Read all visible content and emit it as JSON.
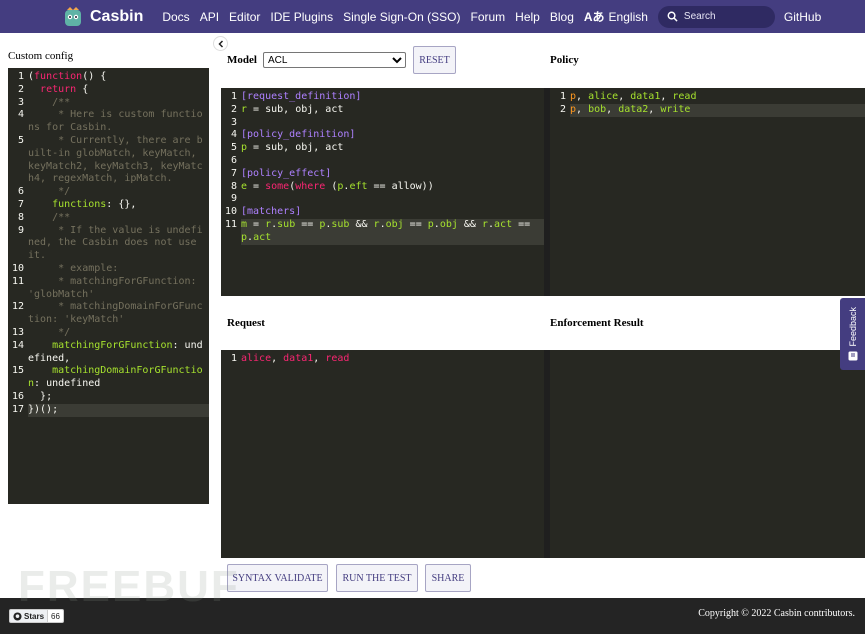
{
  "nav": {
    "brand": "Casbin",
    "links": [
      "Docs",
      "API",
      "Editor",
      "IDE Plugins",
      "Single Sign-On (SSO)",
      "Forum",
      "Help",
      "Blog"
    ],
    "language": "English",
    "search_placeholder": "Search",
    "github": "GitHub"
  },
  "left": {
    "title": "Custom config",
    "lines": [
      {
        "n": "1",
        "t": "(function() {"
      },
      {
        "n": "2",
        "t": "  return {"
      },
      {
        "n": "3",
        "t": "    /**"
      },
      {
        "n": "4",
        "t": "     * Here is custom functions for Casbin."
      },
      {
        "n": "5",
        "t": "     * Currently, there are built-in globMatch, keyMatch, keyMatch2, keyMatch3, keyMatch4, regexMatch, ipMatch."
      },
      {
        "n": "6",
        "t": "     */"
      },
      {
        "n": "7",
        "t": "    functions: {},"
      },
      {
        "n": "8",
        "t": "    /**"
      },
      {
        "n": "9",
        "t": "     * If the value is undefined, the Casbin does not use it."
      },
      {
        "n": "10",
        "t": "     * example:"
      },
      {
        "n": "11",
        "t": "     * matchingForGFunction: 'globMatch'"
      },
      {
        "n": "12",
        "t": "     * matchingDomainForGFunction: 'keyMatch'"
      },
      {
        "n": "13",
        "t": "     */"
      },
      {
        "n": "14",
        "t": "    matchingForGFunction: undefined,"
      },
      {
        "n": "15",
        "t": "    matchingDomainForGFunction: undefined"
      },
      {
        "n": "16",
        "t": "  };"
      },
      {
        "n": "17",
        "t": "})();"
      }
    ]
  },
  "model": {
    "label": "Model",
    "selected": "ACL",
    "reset": "RESET",
    "lines": [
      {
        "n": "1",
        "t": "[request_definition]"
      },
      {
        "n": "2",
        "t": "r = sub, obj, act"
      },
      {
        "n": "3",
        "t": ""
      },
      {
        "n": "4",
        "t": "[policy_definition]"
      },
      {
        "n": "5",
        "t": "p = sub, obj, act"
      },
      {
        "n": "6",
        "t": ""
      },
      {
        "n": "7",
        "t": "[policy_effect]"
      },
      {
        "n": "8",
        "t": "e = some(where (p.eft == allow))"
      },
      {
        "n": "9",
        "t": ""
      },
      {
        "n": "10",
        "t": "[matchers]"
      },
      {
        "n": "11",
        "t": "m = r.sub == p.sub && r.obj == p.obj && r.act == p.act"
      }
    ]
  },
  "policy": {
    "label": "Policy",
    "lines": [
      {
        "n": "1",
        "t": "p, alice, data1, read"
      },
      {
        "n": "2",
        "t": "p, bob, data2, write"
      }
    ]
  },
  "request": {
    "label": "Request",
    "lines": [
      {
        "n": "1",
        "t": "alice, data1, read"
      }
    ]
  },
  "result": {
    "label": "Enforcement Result"
  },
  "actions": {
    "syntax_validate": "SYNTAX VALIDATE",
    "run_test": "RUN THE TEST",
    "share": "SHARE"
  },
  "feedback": "Feedback",
  "footer": {
    "stars_label": "Stars",
    "stars_count": "66",
    "copyright": "Copyright © 2022 Casbin contributors."
  },
  "watermark": "FREEBUF",
  "colors": {
    "nav_bg": "#443d80",
    "editor_bg": "#272822",
    "keyword": "#f92672",
    "section": "#ae81ff",
    "property": "#a6e22e",
    "comment": "#75715e",
    "policy_value": "#fd971f"
  }
}
